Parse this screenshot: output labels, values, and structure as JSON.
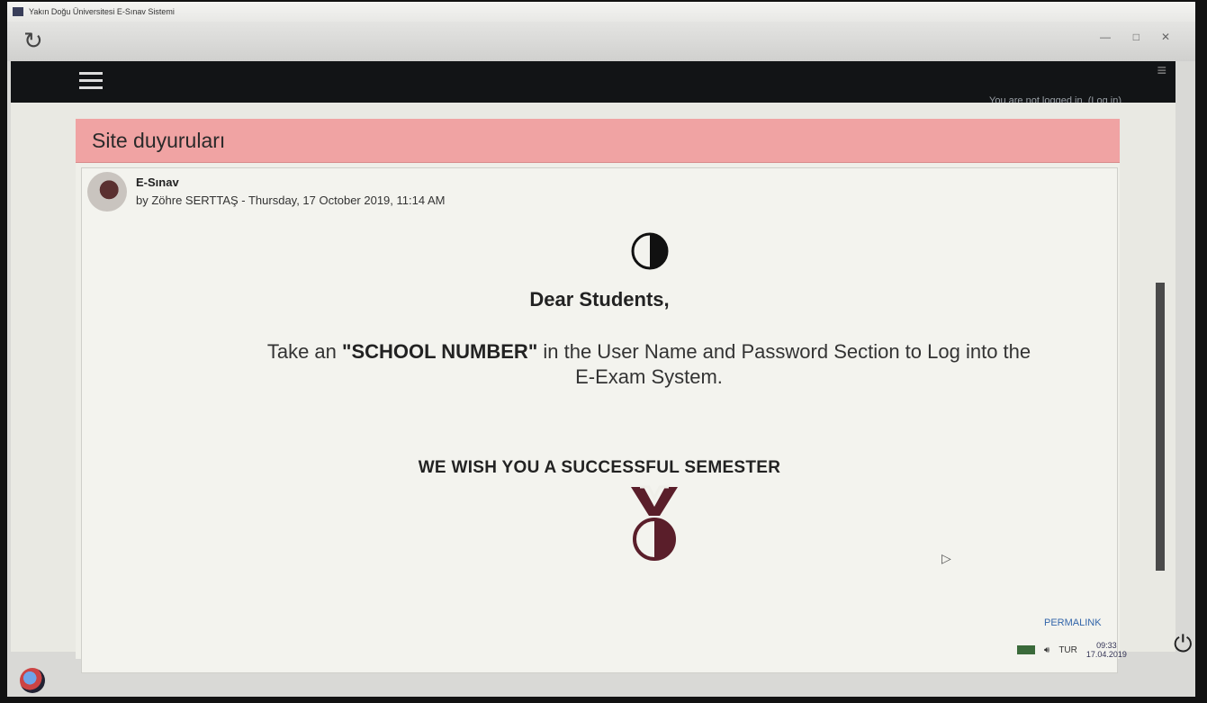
{
  "window": {
    "title": "Yakın Doğu Üniversitesi E-Sınav Sistemi"
  },
  "navbar": {
    "login_status": "You are not logged in. (Log in)"
  },
  "panel": {
    "title": "Site duyuruları"
  },
  "post": {
    "subject": "E-Sınav",
    "meta": "by Zöhre SERTTAŞ - Thursday, 17 October 2019, 11:14 AM",
    "greeting": "Dear Students,",
    "instruction_pre": "Take an ",
    "instruction_bold": "\"SCHOOL NUMBER\"",
    "instruction_post": " in the User Name and Password Section to Log into the E-Exam System.",
    "wish": "WE WISH YOU A SUCCESSFUL SEMESTER",
    "permalink": "PERMALINK"
  },
  "taskbar": {
    "language": "TUR",
    "time": "09:33",
    "date": "17.04.2019"
  },
  "icons": {
    "reload": "reload-icon",
    "menu": "hamburger-icon",
    "logo": "university-logo",
    "power": "power-icon",
    "start": "start-icon",
    "volume": "volume-icon",
    "network": "network-icon"
  },
  "colors": {
    "panel_header": "#f0a3a3",
    "navbar": "#121416",
    "logo": "#5a1e2a"
  }
}
